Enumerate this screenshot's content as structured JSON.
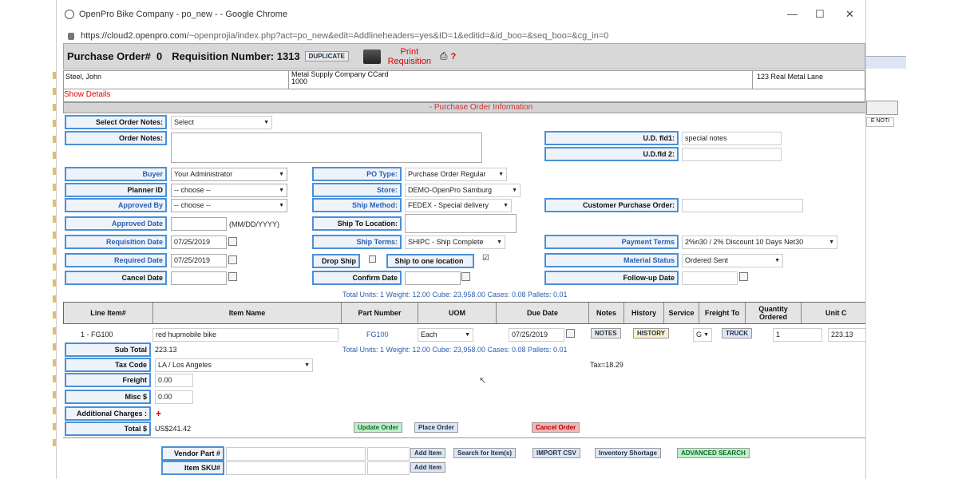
{
  "window": {
    "title": "OpenPro Bike Company - po_new - - Google Chrome",
    "url_host": "https://cloud2.openpro.com",
    "url_path": "/~openprojia/index.php?act=po_new&edit=Addlineheaders=yes&ID=1&editid=&id_boo=&seq_boo=&cg_in=0"
  },
  "header": {
    "po_label": "Purchase Order#",
    "po_number": "0",
    "req_label": "Requisition Number:",
    "req_number": "1313",
    "duplicate": "DUPLICATE",
    "print_req": "Print Requisition",
    "help": "?"
  },
  "vendor": {
    "buyer_name": "Steel, John",
    "company": "Metal Supply Company CCard",
    "code": "1000",
    "address": "123 Real Metal Lane",
    "show_details": "Show Details"
  },
  "section_title": "- Purchase Order Information",
  "form": {
    "select_order_notes": {
      "label": "Select Order Notes:",
      "value": "Select"
    },
    "order_notes": {
      "label": "Order Notes:",
      "value": ""
    },
    "ud_fld1": {
      "label": "U.D. fld1:",
      "value": "special notes"
    },
    "ud_fld2": {
      "label": "U.D.fld 2:",
      "value": ""
    },
    "buyer": {
      "label": "Buyer",
      "value": "Your Administrator"
    },
    "planner_id": {
      "label": "Planner ID",
      "value": "-- choose --"
    },
    "approved_by": {
      "label": "Approved By",
      "value": "-- choose --"
    },
    "approved_date": {
      "label": "Approved Date",
      "value": "",
      "hint": "(MM/DD/YYYY)"
    },
    "requisition_date": {
      "label": "Requisition Date",
      "value": "07/25/2019"
    },
    "required_date": {
      "label": "Required Date",
      "value": "07/25/2019"
    },
    "cancel_date": {
      "label": "Cancel Date",
      "value": ""
    },
    "po_type": {
      "label": "PO Type:",
      "value": "Purchase Order Regular"
    },
    "store": {
      "label": "Store:",
      "value": "DEMO-OpenPro Samburg"
    },
    "ship_method": {
      "label": "Ship Method:",
      "value": "FEDEX - Special delivery"
    },
    "ship_to_location": {
      "label": "Ship To Location:",
      "value": ""
    },
    "ship_terms": {
      "label": "Ship Terms:",
      "value": "SHIPC - Ship Complete"
    },
    "drop_ship": {
      "label": "Drop Ship",
      "checked": false
    },
    "ship_one_location": {
      "label": "Ship to one location",
      "checked": true
    },
    "confirm_date": {
      "label": "Confirm Date",
      "value": ""
    },
    "customer_po": {
      "label": "Customer Purchase Order:",
      "value": ""
    },
    "payment_terms": {
      "label": "Payment Terms",
      "value": "2%n30 / 2% Discount 10 Days Net30"
    },
    "material_status": {
      "label": "Material Status",
      "value": "Ordered Sent"
    },
    "followup_date": {
      "label": "Follow-up Date",
      "value": ""
    }
  },
  "totals_top": "Total Units: 1   Weight: 12.00   Cube: 23,958.00   Cases: 0.08   Pallets: 0.01",
  "columns": {
    "line_item": "Line Item#",
    "item_name": "Item Name",
    "part_number": "Part Number",
    "uom": "UOM",
    "due_date": "Due Date",
    "notes": "Notes",
    "history": "History",
    "service": "Service",
    "freight_to": "Freight To",
    "qty_ordered": "Quantity Ordered",
    "unit_cost": "Unit C"
  },
  "line": {
    "line_item": "1 - FG100",
    "item_name": "red hupmobile bike",
    "part_number": "FG100",
    "uom": "Each",
    "due_date": "07/25/2019",
    "notes_btn": "NOTES",
    "history_btn": "HISTORY",
    "service": "G",
    "truck_btn": "TRUCK",
    "qty": "1",
    "unit_cost": "223.13"
  },
  "summary": {
    "subtotal_label": "Sub Total",
    "subtotal": "223.13",
    "totals_line": "Total Units:  1   Weight: 12.00   Cube: 23,958.00   Cases: 0.08   Pallets: 0.01",
    "taxcode_label": "Tax Code",
    "taxcode": "LA / Los Angeles",
    "tax": "Tax=18.29",
    "freight_label": "Freight",
    "freight": "0.00",
    "misc_label": "Misc $",
    "misc": "0.00",
    "addl_label": "Additional Charges :",
    "addl_plus": "+",
    "total_label": "Total $",
    "total": "US$241.42",
    "update_btn": "Update Order",
    "place_btn": "Place Order",
    "cancel_btn": "Cancel Order"
  },
  "bottom": {
    "vendor_part_label": "Vendor Part #",
    "item_sku_label": "Item SKU#",
    "add_item": "Add Item",
    "add_item2": "Add Item",
    "search_btn": "Search for Item(s)",
    "import_btn": "IMPORT CSV",
    "inventory_btn": "Inventory Shortage",
    "advanced_btn": "ADVANCED SEARCH"
  },
  "right_edge": {
    "btn": "E NOTI"
  }
}
